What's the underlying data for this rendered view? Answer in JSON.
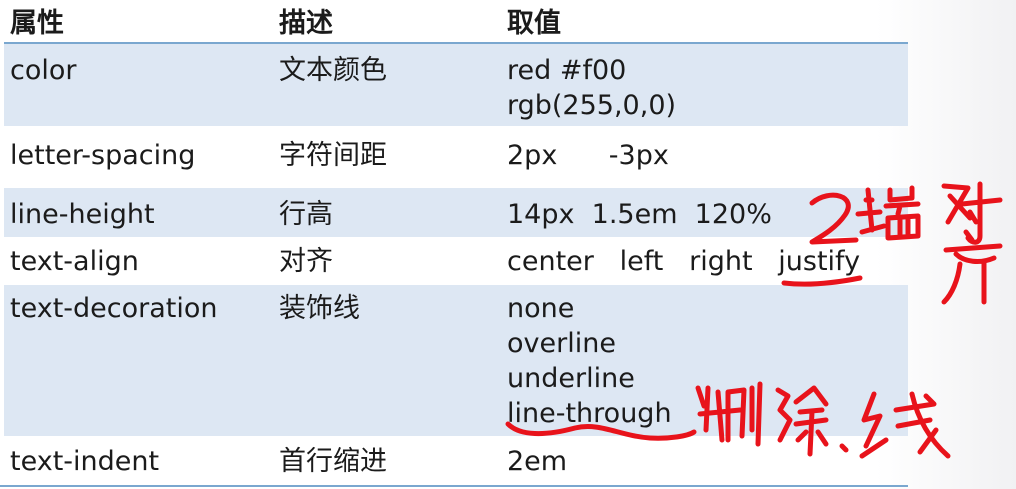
{
  "table": {
    "headers": [
      "属性",
      "描述",
      "取值"
    ],
    "rows": [
      {
        "property": "color",
        "description": "文本颜色",
        "values": [
          "red  #f00",
          "rgb(255,0,0)"
        ]
      },
      {
        "property": "letter-spacing",
        "description": "字符间距",
        "values": [
          "2px      -3px"
        ]
      },
      {
        "property": "line-height",
        "description": "行高",
        "values": [
          "14px  1.5em  120%"
        ]
      },
      {
        "property": "text-align",
        "description": "对齐",
        "values": [
          "center   left   right   justify"
        ]
      },
      {
        "property": "text-decoration",
        "description": "装饰线",
        "values": [
          "none",
          "overline",
          "underline",
          "line-through"
        ]
      },
      {
        "property": "text-indent",
        "description": "首行缩进",
        "values": [
          "2em"
        ]
      }
    ]
  },
  "annotations": {
    "justify_note": "2端对齐",
    "line_through_note": "删除线"
  },
  "colors": {
    "row_shade": "#dde7f3",
    "rule_blue": "#7aa7cf",
    "ink_red": "#e8131b"
  }
}
